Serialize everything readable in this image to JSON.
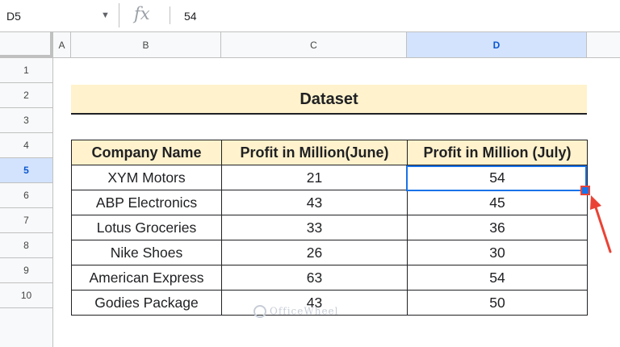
{
  "formula_bar": {
    "cell_ref": "D5",
    "fx_label": "fx",
    "value": "54"
  },
  "columns": [
    "A",
    "B",
    "C",
    "D"
  ],
  "rows": [
    "1",
    "2",
    "3",
    "4",
    "5",
    "6",
    "7",
    "8",
    "9",
    "10"
  ],
  "dataset_title": "Dataset",
  "table": {
    "headers": [
      "Company Name",
      "Profit in Million(June)",
      "Profit in Million (July)"
    ],
    "rows": [
      [
        "XYM Motors",
        "21",
        "54"
      ],
      [
        "ABP Electronics",
        "43",
        "45"
      ],
      [
        "Lotus Groceries",
        "33",
        "36"
      ],
      [
        "Nike Shoes",
        "26",
        "30"
      ],
      [
        "American Express",
        "63",
        "54"
      ],
      [
        "Godies Package",
        "43",
        "50"
      ]
    ]
  },
  "selected_cell": "D5",
  "watermark": "OfficeWheel",
  "colors": {
    "header_fill": "#fff2cc",
    "selection": "#1a73e8",
    "arrow": "#ea4335"
  }
}
